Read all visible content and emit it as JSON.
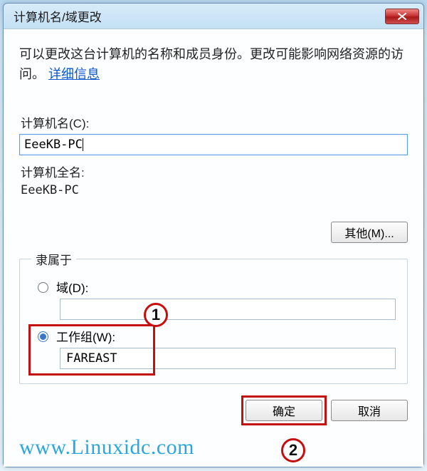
{
  "window": {
    "title": "计算机名/域更改"
  },
  "description": {
    "text_before_link": "可以更改这台计算机的名称和成员身份。更改可能影响网络资源的访问。",
    "link_text": "详细信息"
  },
  "computer_name": {
    "label": "计算机名(C):",
    "value": "EeeKB-PC"
  },
  "full_name": {
    "label": "计算机全名:",
    "value": "EeeKB-PC"
  },
  "buttons": {
    "more": "其他(M)...",
    "ok": "确定",
    "cancel": "取消"
  },
  "member_of": {
    "legend": "隶属于",
    "domain": {
      "label": "域(D):",
      "value": "",
      "selected": false
    },
    "workgroup": {
      "label": "工作组(W):",
      "value": "FAREAST",
      "selected": true
    }
  },
  "annotations": {
    "circle1": "1",
    "circle2": "2"
  },
  "watermark": "www.Linuxidc.com"
}
